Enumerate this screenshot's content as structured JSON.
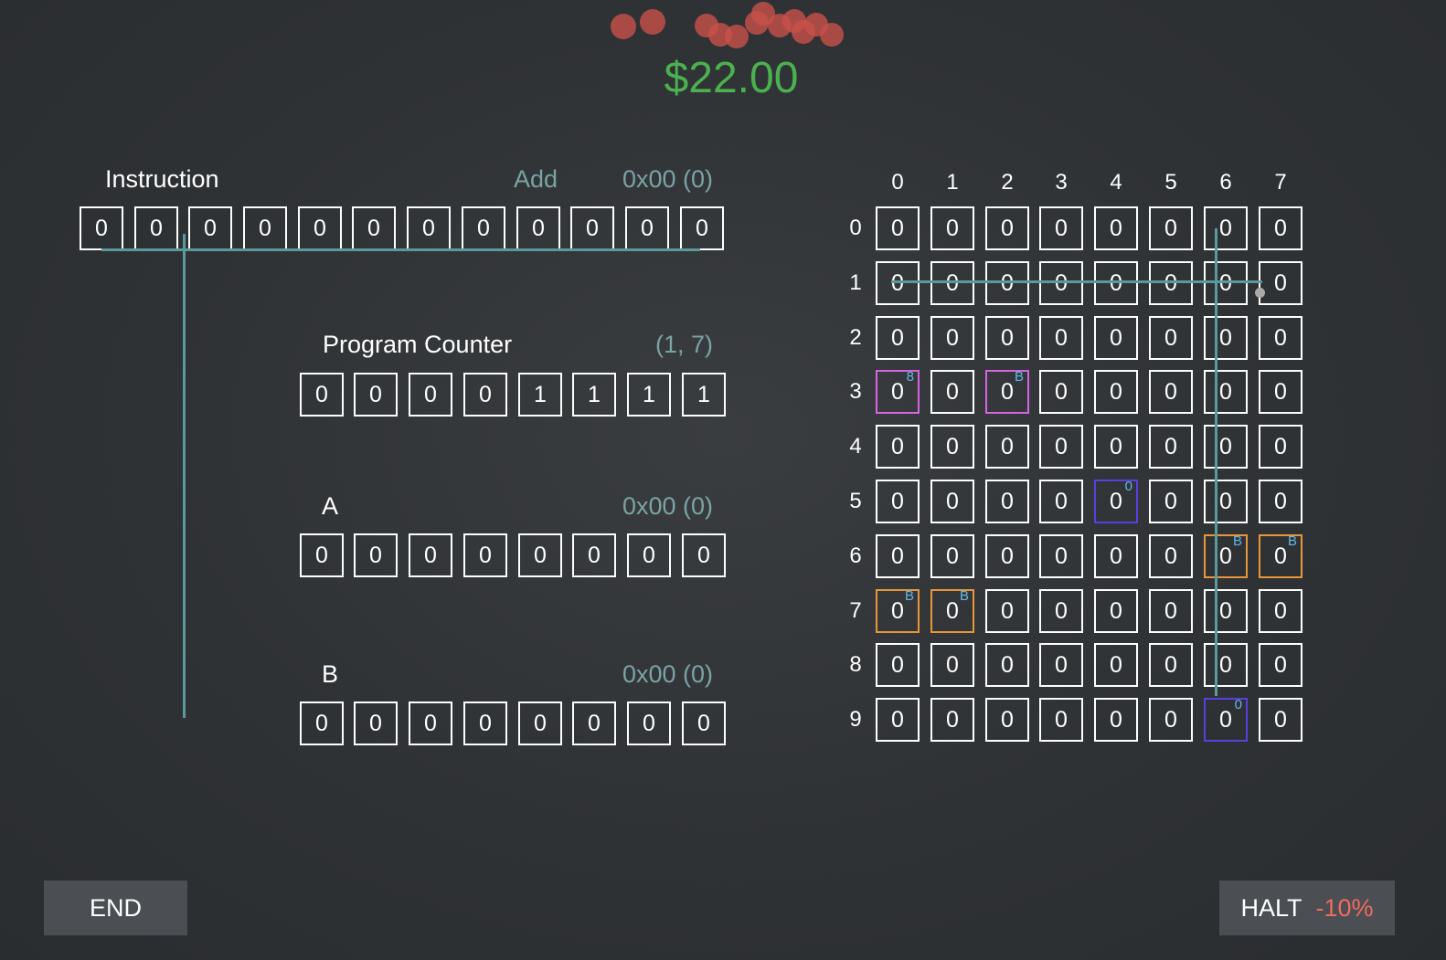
{
  "money": "$22.00",
  "instruction": {
    "label": "Instruction",
    "op": "Add",
    "value": "0x00 (0)",
    "bits": [
      "0",
      "0",
      "0",
      "0",
      "0",
      "0",
      "0",
      "0",
      "0",
      "0",
      "0",
      "0"
    ]
  },
  "program_counter": {
    "label": "Program Counter",
    "value": "(1, 7)",
    "bits": [
      "0",
      "0",
      "0",
      "0",
      "1",
      "1",
      "1",
      "1"
    ]
  },
  "reg_a": {
    "label": "A",
    "value": "0x00 (0)",
    "bits": [
      "0",
      "0",
      "0",
      "0",
      "0",
      "0",
      "0",
      "0"
    ]
  },
  "reg_b": {
    "label": "B",
    "value": "0x00 (0)",
    "bits": [
      "0",
      "0",
      "0",
      "0",
      "0",
      "0",
      "0",
      "0"
    ]
  },
  "memory": {
    "col_headers": [
      "0",
      "1",
      "2",
      "3",
      "4",
      "5",
      "6",
      "7"
    ],
    "row_headers": [
      "0",
      "1",
      "2",
      "3",
      "4",
      "5",
      "6",
      "7",
      "8",
      "9"
    ],
    "cell_value": "0",
    "highlights": [
      {
        "row": 3,
        "col": 0,
        "color": "#d664e0",
        "badge": "8"
      },
      {
        "row": 3,
        "col": 2,
        "color": "#d664e0",
        "badge": "B"
      },
      {
        "row": 5,
        "col": 4,
        "color": "#5a3fe0",
        "badge": "0"
      },
      {
        "row": 6,
        "col": 6,
        "color": "#e8963a",
        "badge": "B"
      },
      {
        "row": 6,
        "col": 7,
        "color": "#e8963a",
        "badge": "B"
      },
      {
        "row": 7,
        "col": 0,
        "color": "#e8963a",
        "badge": "B"
      },
      {
        "row": 7,
        "col": 1,
        "color": "#e8963a",
        "badge": "B"
      },
      {
        "row": 9,
        "col": 6,
        "color": "#5a3fe0",
        "badge": "0"
      }
    ]
  },
  "buttons": {
    "end": "END",
    "halt": "HALT",
    "halt_penalty": "-10%"
  },
  "colors": {
    "money": "#4bb14f",
    "wire": "#5a9a9a",
    "muted_text": "#7aa3a3",
    "penalty": "#f06a5e"
  }
}
